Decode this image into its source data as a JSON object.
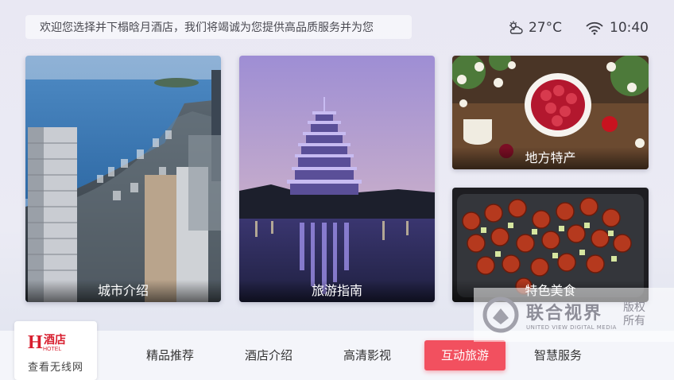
{
  "header": {
    "marquee_text": "欢迎您选择并下榻晗月酒店，我们将竭诚为您提供高品质服务并为您",
    "temperature": "27°C",
    "time": "10:40",
    "weather_icon": "partly-cloudy-icon",
    "wifi_icon": "wifi-icon"
  },
  "tiles": {
    "city": {
      "label": "城市介绍"
    },
    "guide": {
      "label": "旅游指南"
    },
    "specialty": {
      "label": "地方特产"
    },
    "food": {
      "label": "特色美食"
    }
  },
  "watermark": {
    "name": "联合视界",
    "english": "UNITED VIEW DIGITAL MEDIA",
    "rights": "版权所有"
  },
  "hotel": {
    "logo_text": "酒店",
    "logo_sub": "HOTEL",
    "subtitle": "查看无线网"
  },
  "nav": [
    {
      "label": "精品推荐",
      "active": false
    },
    {
      "label": "酒店介绍",
      "active": false
    },
    {
      "label": "高清影视",
      "active": false
    },
    {
      "label": "互动旅游",
      "active": true
    },
    {
      "label": "智慧服务",
      "active": false
    }
  ],
  "colors": {
    "accent": "#f2505f",
    "bg": "#ebebf4"
  }
}
